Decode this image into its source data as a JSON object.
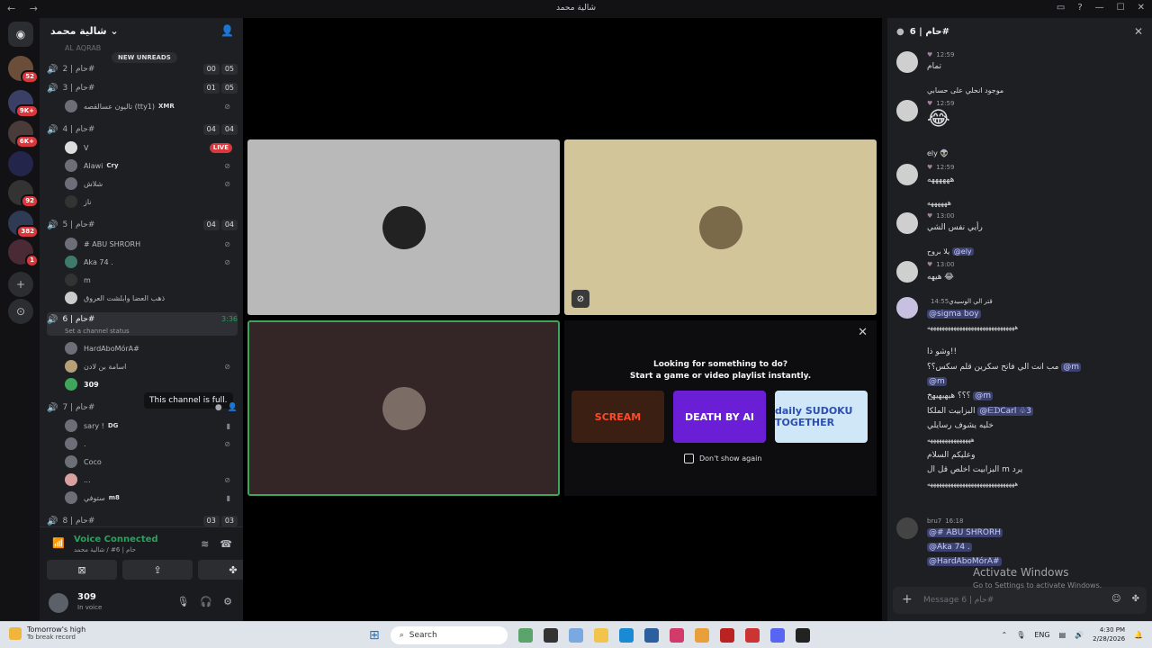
{
  "titlebar": {
    "title": "شالية محمد",
    "nav": "← →",
    "buttons": [
      "▭",
      "?",
      "—",
      "☐",
      "✕"
    ]
  },
  "guilds": {
    "badges": [
      "52",
      "9K+",
      "6K+",
      "92",
      "382",
      "1"
    ]
  },
  "server": {
    "name": "شالية محمد",
    "new_unreads": "NEW UNREADS",
    "top_member": "AL AQRAB"
  },
  "voice_channels": [
    {
      "name": "حام | 2#",
      "counts": [
        "00",
        "05"
      ]
    },
    {
      "name": "حام | 3#",
      "counts": [
        "01",
        "05"
      ]
    },
    {
      "name": "حام | 4#",
      "counts": [
        "04",
        "04"
      ]
    },
    {
      "name": "حام | 5#",
      "counts": [
        "04",
        "04"
      ]
    },
    {
      "name": "حام | 6#",
      "timer": "3:36",
      "status": "Set a channel status"
    },
    {
      "name": "حام | 7#"
    },
    {
      "name": "حام | 8#",
      "counts": [
        "03",
        "03"
      ]
    }
  ],
  "members": {
    "c3": [
      {
        "name": "تاليون عسالقصه (tty1)",
        "tag": "XMR"
      }
    ],
    "c4": [
      {
        "name": "V",
        "live": "LIVE"
      },
      {
        "name": "Alawi",
        "tag": "Cry"
      },
      {
        "name": "شلاش"
      },
      {
        "name": "ناز"
      }
    ],
    "c5": [
      {
        "name": "# ABU SHRORH"
      },
      {
        "name": "Aka 74 ."
      },
      {
        "name": "m"
      },
      {
        "name": "ذهب العضا وابلشت العروق"
      }
    ],
    "c6": [
      {
        "name": "HardAboMórA#"
      },
      {
        "name": "اسامة بن لادن"
      },
      {
        "name": "309"
      }
    ],
    "c7": [
      {
        "name": "sary !",
        "tag": "DG"
      },
      {
        "name": "."
      },
      {
        "name": "Coco"
      },
      {
        "name": "..."
      },
      {
        "name": "ستوفي",
        "tag": "m8"
      }
    ]
  },
  "tooltip": "This channel is full.",
  "voice_panel": {
    "title": "Voice Connected",
    "subtitle": "حام | 6# / شالية محمد"
  },
  "user": {
    "name": "309",
    "status": "In voice"
  },
  "activity": {
    "line1": "Looking for something to do?",
    "line2": "Start a game or video playlist instantly.",
    "games": [
      "SCREAM",
      "DEATH BY AI",
      "daily SUDOKU TOGETHER"
    ],
    "dont_show": "Don't show again"
  },
  "chat": {
    "channel": "حام | 6#",
    "messages": {
      "m1_text": "تمام",
      "m2_text": "موجود انحلي على حسابي",
      "m2_emoji": "😂",
      "m3_user": "ely 👽",
      "m3_text": "ههههههه",
      "m4_reply": "ههههههه",
      "m4_text": "رأيي نفس الشي",
      "m5_reply": "يلا بروح",
      "m5_mention": "@ely",
      "m5_text": "هيهه 😂",
      "m6_user": "قتر الي الوسيدي",
      "m6_time": "14:55",
      "m6_mention": "@sigma boy",
      "m6_l1": "ههههههههههههههههههههههههههههههه",
      "m6_l2": "وشو ذا!!",
      "m6_l3": "مب انت الي فاتح سكرين قلم سكس؟؟",
      "m6_l3m": "@m",
      "m6_l4m": "@m",
      "m6_l5": "؟؟؟ هيهيهيهخ",
      "m6_l5m": "@m",
      "m6_l6": "البزابيت الملكا",
      "m6_l6m": "@ᗴᗪCarl ♧3",
      "m6_l7": "خليه يشوف رسايلي",
      "m6_l8": "هههههههههههههههه",
      "m6_l9": "وعليكم السلام",
      "m6_l10": "البزابيت اخلص قل ال m يرد",
      "m6_l11": "ههههههههههههههههههههههههههههههه",
      "m7_user": "bru7",
      "m7_time": "16:18",
      "m7_m1": "@# ABU SHRORH",
      "m7_m2": "@Aka 74 .",
      "m7_m3": "@HardAboMórA#"
    },
    "times": [
      "12:59",
      "12:59",
      "12:59",
      "13:00",
      "13:00"
    ],
    "placeholder": "Message حام | 6#"
  },
  "watermark": {
    "line1": "Activate Windows",
    "line2": "Go to Settings to activate Windows."
  },
  "taskbar": {
    "weather_title": "Tomorrow's high",
    "weather_sub": "To break record",
    "search": "Search",
    "lang": "ENG",
    "time": "4:30 PM",
    "date": "2/28/2026"
  }
}
